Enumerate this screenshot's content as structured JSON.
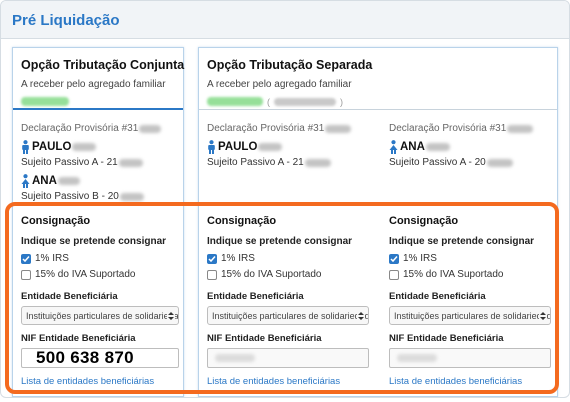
{
  "header": {
    "title": "Pré Liquidação"
  },
  "conjunta": {
    "title": "Opção Tributação Conjunta",
    "subtitle": "A receber pelo agregado familiar",
    "declaration_label": "Declaração Provisória #31",
    "persons": [
      {
        "name": "PAULO",
        "subject": "Sujeito Passivo A - 21"
      },
      {
        "name": "ANA",
        "subject": "Sujeito Passivo B - 20"
      }
    ],
    "consignacao": {
      "title": "Consignação",
      "question": "Indique se pretende consignar",
      "options": [
        {
          "label": "1% IRS",
          "checked": true
        },
        {
          "label": "15% do IVA Suportado",
          "checked": false
        }
      ],
      "entity_label": "Entidade Beneficiária",
      "entity_value": "Instituições particulares de solidariedade social",
      "nif_label": "NIF Entidade Beneficiária",
      "nif_value": "500 638 870",
      "link": "Lista de entidades beneficiárias"
    }
  },
  "separada": {
    "title": "Opção Tributação Separada",
    "subtitle": "A receber pelo agregado familiar",
    "amount_open_paren": "(",
    "amount_close_paren": ")",
    "columns": [
      {
        "declaration_label": "Declaração Provisória #31",
        "person_name": "PAULO",
        "subject": "Sujeito Passivo A - 21",
        "consignacao": {
          "title": "Consignação",
          "question": "Indique se pretende consignar",
          "options": [
            {
              "label": "1% IRS",
              "checked": true
            },
            {
              "label": "15% do IVA Suportado",
              "checked": false
            }
          ],
          "entity_label": "Entidade Beneficiária",
          "entity_value": "Instituições particulares de solidariedade social",
          "nif_label": "NIF Entidade Beneficiária",
          "nif_value": "",
          "link": "Lista de entidades beneficiárias"
        }
      },
      {
        "declaration_label": "Declaração Provisória #31",
        "person_name": "ANA",
        "subject": "Sujeito Passivo A - 20",
        "consignacao": {
          "title": "Consignação",
          "question": "Indique se pretende consignar",
          "options": [
            {
              "label": "1% IRS",
              "checked": true
            },
            {
              "label": "15% do IVA Suportado",
              "checked": false
            }
          ],
          "entity_label": "Entidade Beneficiária",
          "entity_value": "Instituições particulares de solidariedade social",
          "nif_label": "NIF Entidade Beneficiária",
          "nif_value": "",
          "link": "Lista de entidades beneficiárias"
        }
      }
    ]
  },
  "colors": {
    "accent": "#2b78c6",
    "highlight": "#f46a1f",
    "amount_blur": "#8bdc8e",
    "male_icon": "#2b78c6",
    "female_icon": "#2b78c6"
  },
  "icons": {
    "person_male": "person-male-icon",
    "person_female": "person-female-icon",
    "checkbox": "check-icon",
    "select_arrow": "updown-arrow-icon"
  }
}
